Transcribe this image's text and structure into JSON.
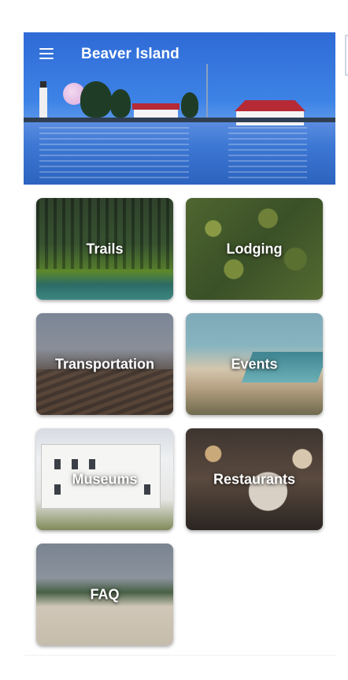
{
  "app": {
    "title": "Beaver Island",
    "menu_icon": "hamburger-menu-icon"
  },
  "tiles": [
    {
      "label": "Trails"
    },
    {
      "label": "Lodging"
    },
    {
      "label": "Transportation"
    },
    {
      "label": "Events"
    },
    {
      "label": "Museums"
    },
    {
      "label": "Restaurants"
    },
    {
      "label": "FAQ"
    }
  ],
  "colors": {
    "header_sky": "#3d83e6",
    "label_text": "#ffffff"
  }
}
